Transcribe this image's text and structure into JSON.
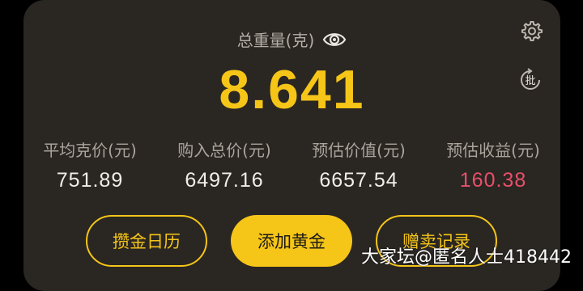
{
  "header": {
    "title": "总重量(克)",
    "eye_icon": "eye-icon",
    "settings_icon": "gear-icon",
    "batch_icon": "batch-icon",
    "batch_label": "批"
  },
  "total_weight": "8.641",
  "stats": [
    {
      "label": "平均克价(元)",
      "value": "751.89"
    },
    {
      "label": "购入总价(元)",
      "value": "6497.16"
    },
    {
      "label": "预估价值(元)",
      "value": "6657.54"
    },
    {
      "label": "预估收益(元)",
      "value": "160.38"
    }
  ],
  "buttons": {
    "calendar": "攒金日历",
    "add": "添加黄金",
    "records": "赠卖记录"
  },
  "watermark": "大家坛@匿名人士418442",
  "colors": {
    "accent": "#f5c518",
    "profit": "#e8506a",
    "card": "#2a2622"
  }
}
